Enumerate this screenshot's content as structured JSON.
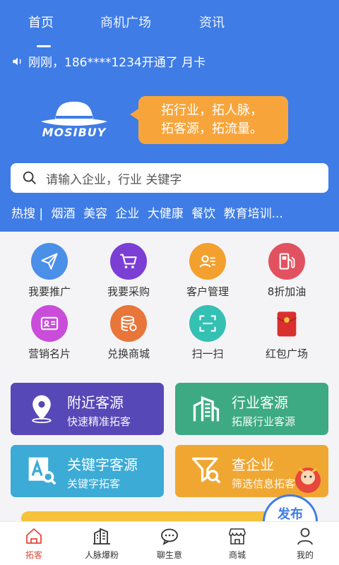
{
  "header": {
    "tabs": [
      {
        "label": "首页"
      },
      {
        "label": "商机广场"
      },
      {
        "label": "资讯"
      }
    ],
    "notice": "刚刚，186****1234开通了 月卡",
    "logo_text": "MOSIBUY",
    "bubble": {
      "line1": "拓行业，拓人脉，",
      "line2": "拓客源，拓流量。"
    },
    "search_placeholder": "请输入企业，行业  关键字",
    "hot": {
      "label": "热搜 |",
      "items": [
        "烟酒",
        "美容",
        "企业",
        "大健康",
        "餐饮",
        "教育培训..."
      ]
    }
  },
  "grid": [
    {
      "label": "我要推广",
      "icon": "paper-plane-icon",
      "color": "#4a8fe8"
    },
    {
      "label": "我要采购",
      "icon": "shopping-cart-icon",
      "color": "#7b3fd6"
    },
    {
      "label": "客户管理",
      "icon": "customer-card-icon",
      "color": "#f4a02f"
    },
    {
      "label": "8折加油",
      "icon": "fuel-pump-icon",
      "color": "#e2515f"
    },
    {
      "label": "营销名片",
      "icon": "business-card-icon",
      "color": "#c94dd9"
    },
    {
      "label": "兑换商城",
      "icon": "coin-stack-icon",
      "color": "#e8753a"
    },
    {
      "label": "扫一扫",
      "icon": "scan-icon",
      "color": "#35c0b4"
    },
    {
      "label": "红包广场",
      "icon": "red-envelope-icon",
      "color": "#d9302f"
    }
  ],
  "cards": [
    {
      "title": "附近客源",
      "subtitle": "快速精准拓客",
      "icon": "location-pin-icon",
      "color": "#5748b8"
    },
    {
      "title": "行业客源",
      "subtitle": "拓展行业客源",
      "icon": "buildings-icon",
      "color": "#3daa84"
    },
    {
      "title": "关键字客源",
      "subtitle": "关键字拓客",
      "icon": "keyword-search-icon",
      "color": "#3cabd6"
    },
    {
      "title": "查企业",
      "subtitle": "筛选信息拓客",
      "icon": "filter-search-icon",
      "color": "#f0a732"
    }
  ],
  "fab": {
    "label": "发布\n广告"
  },
  "bottom_nav": [
    {
      "label": "拓客",
      "icon": "home-icon",
      "active": true
    },
    {
      "label": "人脉爆粉",
      "icon": "building-icon",
      "active": false
    },
    {
      "label": "聊生意",
      "icon": "chat-bubble-icon",
      "active": false
    },
    {
      "label": "商城",
      "icon": "shop-icon",
      "active": false
    },
    {
      "label": "我的",
      "icon": "user-icon",
      "active": false
    }
  ],
  "colors": {
    "primary": "#3f7ce6",
    "bubble": "#f7a53b",
    "active_nav": "#e24a3a"
  }
}
